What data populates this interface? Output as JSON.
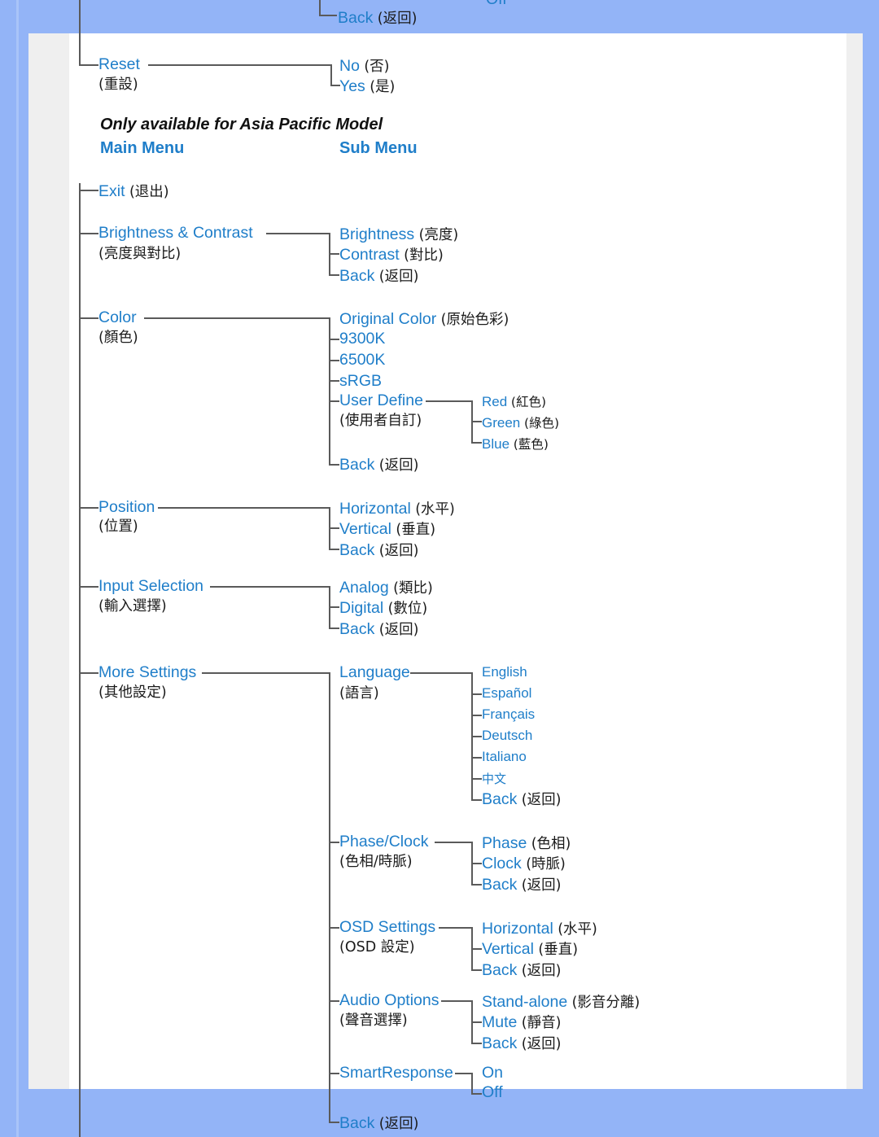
{
  "colors": {
    "page_background": "#93b4f7",
    "content_background": "#ffffff",
    "gutter_background": "#efefef",
    "link_blue": "#1f7ec9",
    "text_black": "#1a1a1a",
    "connector_gray": "#5a5a5a"
  },
  "notes": {
    "asia_pacific": "Only available for Asia Pacific Model"
  },
  "headings": {
    "main_menu": "Main Menu",
    "sub_menu": "Sub Menu"
  },
  "top_partial": {
    "back": "Back",
    "back_zh": "(返回)",
    "cut_off_fragment": "Off"
  },
  "tree": {
    "reset": {
      "label": "Reset",
      "label_zh": "(重設)",
      "children": [
        {
          "label": "No",
          "label_zh": "(否)"
        },
        {
          "label": "Yes",
          "label_zh": "(是)"
        }
      ]
    },
    "exit": {
      "label": "Exit",
      "label_zh": "(退出)"
    },
    "brightness_contrast": {
      "label": "Brightness &  Contrast",
      "label_zh": "(亮度與對比)",
      "children": [
        {
          "label": "Brightness",
          "label_zh": "(亮度)"
        },
        {
          "label": "Contrast",
          "label_zh": "(對比)"
        },
        {
          "label": "Back",
          "label_zh": "(返回)"
        }
      ]
    },
    "color": {
      "label": "Color",
      "label_zh": "(顏色)",
      "children": [
        {
          "label": "Original Color",
          "label_zh": "(原始色彩)"
        },
        {
          "label": "9300K",
          "label_zh": ""
        },
        {
          "label": "6500K",
          "label_zh": ""
        },
        {
          "label": "sRGB",
          "label_zh": ""
        },
        {
          "label": "User Define",
          "label_zh": "(使用者自訂)"
        },
        {
          "label": "Back",
          "label_zh": "(返回)"
        }
      ],
      "user_define_children": [
        {
          "label": "Red",
          "label_zh": "(紅色)"
        },
        {
          "label": "Green",
          "label_zh": "(綠色)"
        },
        {
          "label": "Blue",
          "label_zh": "(藍色)"
        }
      ]
    },
    "position": {
      "label": "Position",
      "label_zh": "(位置)",
      "children": [
        {
          "label": "Horizontal",
          "label_zh": "(水平)"
        },
        {
          "label": "Vertical",
          "label_zh": "(垂直)"
        },
        {
          "label": "Back",
          "label_zh": "(返回)"
        }
      ]
    },
    "input_selection": {
      "label": "Input Selection",
      "label_zh": "(輸入選擇)",
      "children": [
        {
          "label": "Analog",
          "label_zh": "(類比)"
        },
        {
          "label": "Digital",
          "label_zh": "(數位)"
        },
        {
          "label": "Back",
          "label_zh": "(返回)"
        }
      ]
    },
    "more_settings": {
      "label": "More Settings",
      "label_zh": "(其他設定)",
      "language": {
        "label": "Language",
        "label_zh": "(語言)",
        "children": [
          {
            "label": "English",
            "label_zh": ""
          },
          {
            "label": "Español",
            "label_zh": ""
          },
          {
            "label": "Français",
            "label_zh": ""
          },
          {
            "label": "Deutsch",
            "label_zh": ""
          },
          {
            "label": "Italiano",
            "label_zh": ""
          },
          {
            "label": "中文",
            "label_zh": ""
          },
          {
            "label": "Back",
            "label_zh": "(返回)"
          }
        ]
      },
      "phase_clock": {
        "label": "Phase/Clock",
        "label_zh": "(色相/時脈)",
        "children": [
          {
            "label": "Phase",
            "label_zh": "(色相)"
          },
          {
            "label": "Clock",
            "label_zh": "(時脈)"
          },
          {
            "label": "Back",
            "label_zh": "(返回)"
          }
        ]
      },
      "osd_settings": {
        "label": "OSD Settings",
        "label_zh": "(OSD 設定)",
        "children": [
          {
            "label": "Horizontal",
            "label_zh": "(水平)"
          },
          {
            "label": "Vertical",
            "label_zh": "(垂直)"
          },
          {
            "label": "Back",
            "label_zh": "(返回)"
          }
        ]
      },
      "audio_options": {
        "label": "Audio Options",
        "label_zh": "(聲音選擇)",
        "children": [
          {
            "label": "Stand-alone",
            "label_zh": "(影音分離)"
          },
          {
            "label": "Mute",
            "label_zh": "(靜音)"
          },
          {
            "label": "Back",
            "label_zh": "(返回)"
          }
        ]
      },
      "smart_response": {
        "label": "SmartResponse",
        "label_zh": "",
        "children": [
          {
            "label": "On",
            "label_zh": ""
          },
          {
            "label": "Off",
            "label_zh": ""
          }
        ]
      },
      "back": {
        "label": "Back",
        "label_zh": "(返回)"
      }
    }
  }
}
